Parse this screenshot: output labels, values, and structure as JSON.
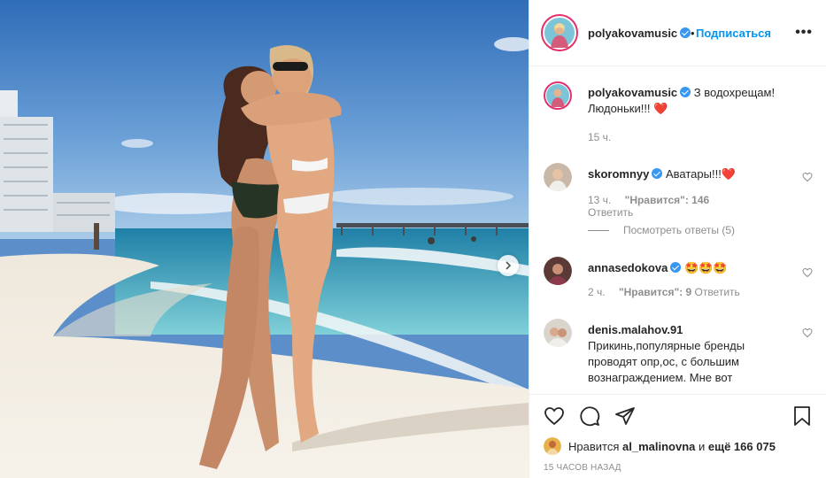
{
  "post": {
    "username": "polyakovamusic",
    "follow_label": "Подписаться",
    "separator": "•",
    "more_label": "•••"
  },
  "caption": {
    "username": "polyakovamusic",
    "text": "З водохрещам! Людоньки!!!",
    "emoji": "❤️",
    "time": "15 ч."
  },
  "comments": [
    {
      "username": "skoromnyy",
      "verified": true,
      "text": "Аватары!!!",
      "emoji": "❤️",
      "time": "13 ч.",
      "likes": "\"Нравится\": 146",
      "reply": "Ответить",
      "view_replies": "Посмотреть ответы (5)"
    },
    {
      "username": "annasedokova",
      "verified": true,
      "text": "",
      "emoji": "🤩🤩🤩",
      "time": "2 ч.",
      "likes": "\"Нравится\": 9",
      "reply": "Ответить"
    },
    {
      "username": "denis.malahov.91",
      "verified": false,
      "text": "Прикинь,популярные бренды проводят опр,ос, с большим вознаграждением. Мне вот",
      "time": "",
      "likes": "",
      "reply": ""
    }
  ],
  "likes": {
    "prefix": "Нравится",
    "user": "al_malinovna",
    "middle": "и",
    "rest": "ещё 166 075"
  },
  "timestamp": "15 ЧАСОВ НАЗАД",
  "colors": {
    "accent": "#0095f6",
    "verified": "#3897f0",
    "muted": "#8e8e8e",
    "text": "#262626"
  },
  "icons": [
    "like-icon",
    "comment-icon",
    "share-icon",
    "save-icon",
    "more-icon",
    "next-arrow-icon",
    "verified-icon"
  ]
}
